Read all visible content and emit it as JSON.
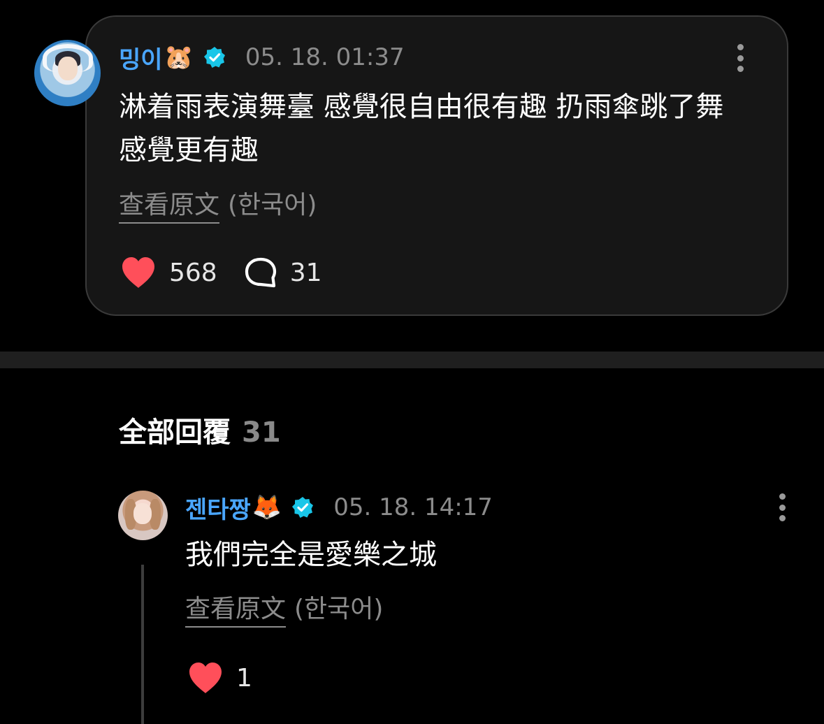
{
  "post": {
    "username": "밍이",
    "username_emoji": "🐹",
    "timestamp": "05. 18. 01:37",
    "text": "淋着雨表演舞臺 感覺很自由很有趣 扔雨傘跳了舞 感覺更有趣",
    "translate_link": "查看原文",
    "translate_lang": "(한국어)",
    "likes": "568",
    "comments": "31",
    "icons": {
      "verified": "verified-badge-icon",
      "more": "more-options-icon",
      "like": "heart-icon",
      "comment": "comment-bubble-icon"
    }
  },
  "replies_section": {
    "label": "全部回覆",
    "count": "31"
  },
  "reply": {
    "username": "젠타짱",
    "username_emoji": "🦊",
    "timestamp": "05. 18. 14:17",
    "text": "我們完全是愛樂之城",
    "translate_link": "查看原文",
    "translate_lang": "(한국어)",
    "likes": "1"
  },
  "colors": {
    "background": "#000000",
    "card": "#161616",
    "username": "#4aa6ff",
    "verified": "#19c6e8",
    "heart": "#ff4f5a",
    "muted": "#8c8c8c"
  }
}
